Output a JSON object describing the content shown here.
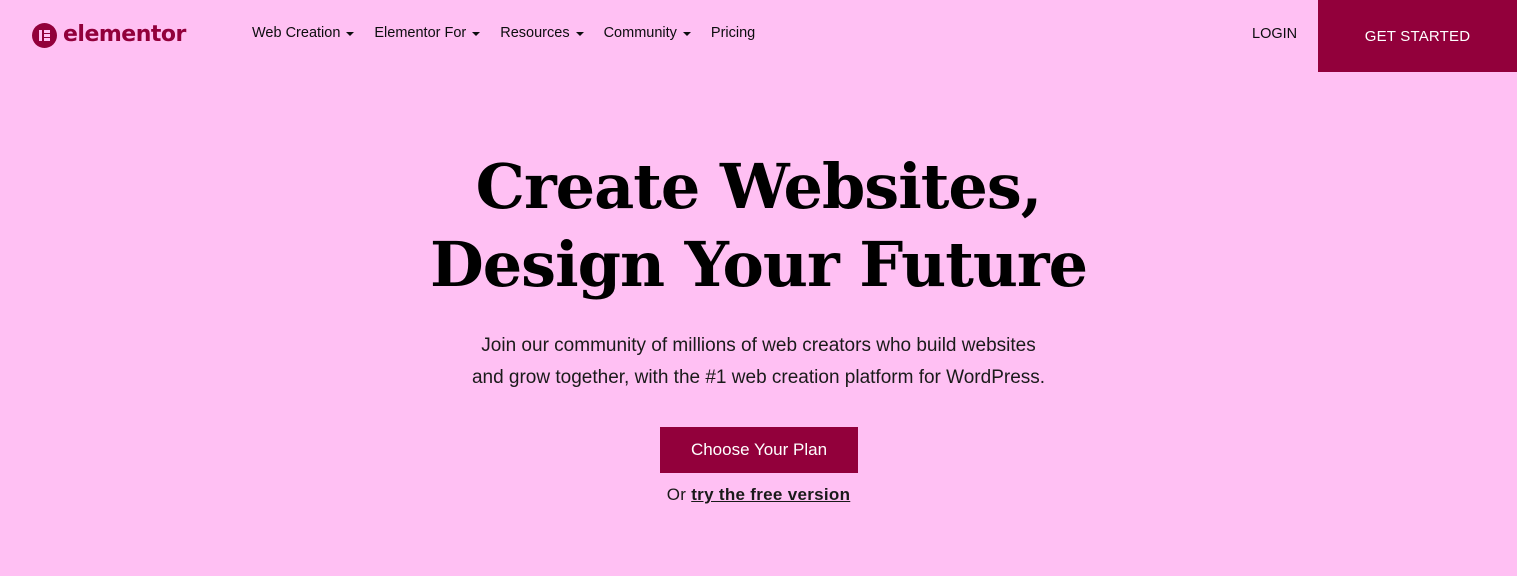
{
  "brand": {
    "name": "elementor",
    "accent_color": "#92003b",
    "background_color": "#ffc0f3",
    "logo_icon": "elementor-logo-icon"
  },
  "nav": {
    "items": [
      {
        "label": "Web Creation",
        "has_dropdown": true
      },
      {
        "label": "Elementor For",
        "has_dropdown": true
      },
      {
        "label": "Resources",
        "has_dropdown": true
      },
      {
        "label": "Community",
        "has_dropdown": true
      },
      {
        "label": "Pricing",
        "has_dropdown": false
      }
    ],
    "dropdown_icon": "caret-down-icon",
    "login_label": "LOGIN",
    "get_started_label": "GET STARTED"
  },
  "hero": {
    "title_line_1": "Create Websites,",
    "title_line_2": "Design Your Future",
    "subtitle_line_1": "Join our community of millions of web creators who build websites",
    "subtitle_line_2": "and grow together, with the #1 web creation platform for WordPress.",
    "cta_label": "Choose Your Plan",
    "free_prefix": "Or",
    "free_link_label": "try the free version"
  }
}
